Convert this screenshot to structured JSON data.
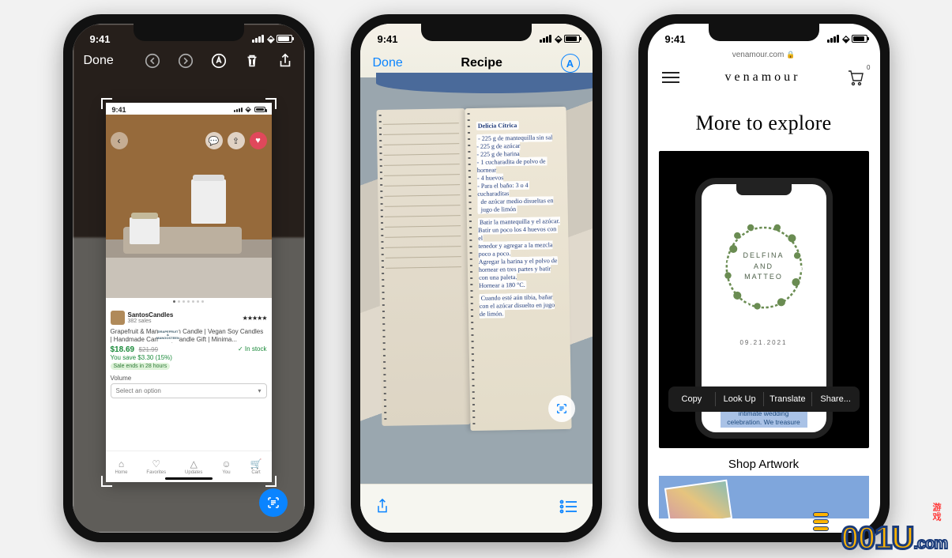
{
  "status_time": "9:41",
  "phone1": {
    "done": "Done",
    "inner_time": "9:41",
    "seller": "SantosCandles",
    "sales": "382 sales",
    "stars": "★★★★★",
    "title": "Grapefruit & Mangosteen Candle | Vegan Soy Candles | Handmade Candles | Candle Gift | Minima...",
    "candle_label": "GRAPEFRUIT &\nMANGOSTEEN",
    "price": "$18.69",
    "old_price": "$21.99",
    "stock": "In stock",
    "save": "You save $3.30 (15%)",
    "sale_pill": "Sale ends in 28 hours",
    "volume": "Volume",
    "select": "Select an option",
    "tabs": {
      "home": "Home",
      "favorites": "Favorites",
      "updates": "Updates",
      "you": "You",
      "cart": "Cart"
    }
  },
  "phone2": {
    "done": "Done",
    "title": "Recipe",
    "heading": "Delicia Cítrica",
    "ingredients": "- 225 g de mantequilla sin sal\n- 225 g de azúcar\n- 225 g de harina\n- 1 cucharadita de polvo de hornear\n- 4 huevos\n- Para el baño: 3 o 4 cucharaditas\n  de azúcar medio disueltas en\n  jugo de limón",
    "steps": "Batir la mantequilla y el azúcar.\nBatir un poco los 4 huevos con el\ntenedor y agregar a la mezcla\npoco a poco.\nAgregar la harina y el polvo de\nhornear en tres partes y batir\ncon una paleta.\nHornear a 180 °C.",
    "final": "Cuando esté aún tibia, bañar\ncon el azúcar disuelto en jugo\nde limón."
  },
  "phone3": {
    "url": "venamour.com",
    "brand": "venamour",
    "cart_badge": "0",
    "heading": "More to explore",
    "name1": "DELFINA",
    "and": "AND",
    "name2": "MATTEO",
    "date": "09.21.2021",
    "menu": {
      "copy": "Copy",
      "lookup": "Look Up",
      "translate": "Translate",
      "share": "Share..."
    },
    "selected_text": "We would be delighted by your presence at our intimate wedding celebration. We treasure",
    "shop": "Shop Artwork"
  },
  "watermark": "001U",
  "watermark_suffix": ".com",
  "watermark_side": "游戏"
}
